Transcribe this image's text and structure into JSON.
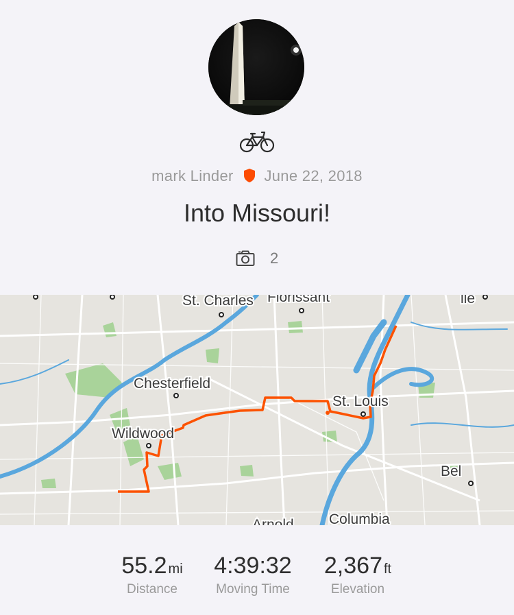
{
  "activity": {
    "athlete_name": "mark Linder",
    "date": "June 22, 2018",
    "title": "Into Missouri!",
    "photo_count": "2",
    "sport_icon": "bicycle-icon",
    "badge_icon": "shield-icon",
    "accent_color": "#fc4c02"
  },
  "map": {
    "labels": [
      "St. Charles",
      "Florissant",
      "Chesterfield",
      "St. Louis",
      "Wildwood",
      "Bel",
      "Columbia",
      "Arnold",
      "lle"
    ]
  },
  "stats": [
    {
      "value": "55.2",
      "unit": "mi",
      "label": "Distance"
    },
    {
      "value": "4:39:32",
      "unit": "",
      "label": "Moving Time"
    },
    {
      "value": "2,367",
      "unit": "ft",
      "label": "Elevation"
    }
  ]
}
